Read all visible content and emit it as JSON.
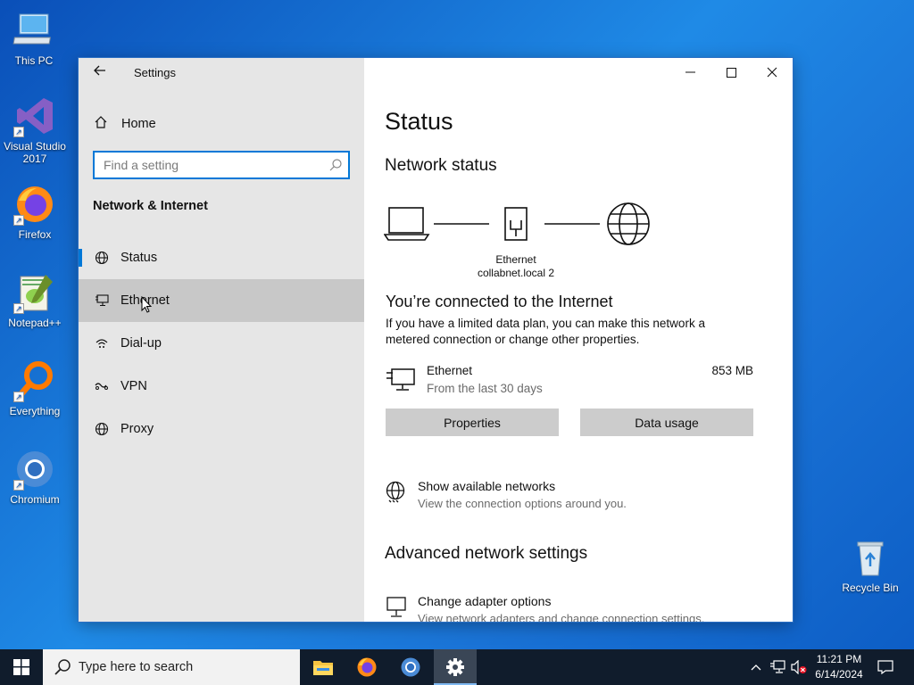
{
  "desktop": {
    "icons": [
      {
        "label_line1": "This PC",
        "label_line2": ""
      },
      {
        "label_line1": "Visual Studio",
        "label_line2": "2017"
      },
      {
        "label_line1": "Firefox",
        "label_line2": ""
      },
      {
        "label_line1": "Notepad++",
        "label_line2": ""
      },
      {
        "label_line1": "Everything",
        "label_line2": ""
      },
      {
        "label_line1": "Chromium",
        "label_line2": ""
      },
      {
        "label_line1": "Recycle Bin",
        "label_line2": ""
      }
    ]
  },
  "window": {
    "title": "Settings",
    "controls": {
      "minimize": "minimize-icon",
      "maximize": "maximize-icon",
      "close": "close-icon"
    },
    "sidebar": {
      "home_label": "Home",
      "search_placeholder": "Find a setting",
      "search_value": "",
      "section_title": "Network & Internet",
      "items": [
        {
          "label": "Status",
          "icon": "globe-status-icon",
          "selected": true
        },
        {
          "label": "Ethernet",
          "icon": "ethernet-icon",
          "hovered": true
        },
        {
          "label": "Dial-up",
          "icon": "dialup-icon"
        },
        {
          "label": "VPN",
          "icon": "vpn-icon"
        },
        {
          "label": "Proxy",
          "icon": "globe-icon"
        }
      ]
    },
    "content": {
      "page_title": "Status",
      "network_status_heading": "Network status",
      "diagram": {
        "adapter_label": "Ethernet",
        "network_label": "collabnet.local 2"
      },
      "connected_heading": "You’re connected to the Internet",
      "connected_desc": "If you have a limited data plan, you can make this network a metered connection or change other properties.",
      "connection": {
        "name": "Ethernet",
        "sub": "From the last 30 days",
        "usage": "853 MB"
      },
      "buttons": {
        "properties": "Properties",
        "data_usage": "Data usage"
      },
      "show_networks": {
        "title": "Show available networks",
        "sub": "View the connection options around you."
      },
      "advanced_heading": "Advanced network settings",
      "adapter_options": {
        "title": "Change adapter options",
        "sub": "View network adapters and change connection settings."
      }
    }
  },
  "taskbar": {
    "search_placeholder": "Type here to search",
    "clock_time": "11:21 PM",
    "clock_date": "6/14/2024"
  },
  "colors": {
    "accent": "#0078d7",
    "taskbar": "#101c2c",
    "sidebar": "#e6e6e6",
    "button": "#cccccc"
  }
}
